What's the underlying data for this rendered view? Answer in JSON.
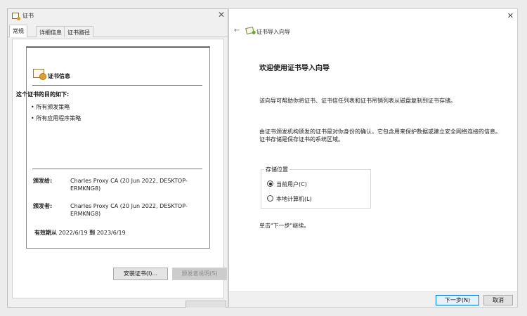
{
  "cert_window": {
    "title": "证书",
    "close_glyph": "✕",
    "icon": "certificate-icon",
    "tabs": [
      {
        "label": "常规",
        "active": true
      },
      {
        "label": "详细信息",
        "active": false
      },
      {
        "label": "证书路径",
        "active": false
      }
    ],
    "info": {
      "heading": "证书信息",
      "purpose_heading": "这个证书的目的如下:",
      "purposes": [
        "所有颁发策略",
        "所有应用程序策略"
      ],
      "issued_to_label": "颁发给:",
      "issued_to_value": "Charles Proxy CA (20 Jun 2022, DESKTOP-ERMKNG8)",
      "issued_by_label": "颁发者:",
      "issued_by_value": "Charles Proxy CA (20 Jun 2022, DESKTOP-ERMKNG8)",
      "valid_from_label": "有效期从",
      "valid_from": "2022/6/19",
      "valid_to_label": "到",
      "valid_to": "2023/6/19"
    },
    "buttons": {
      "install": "安装证书(I)...",
      "issuer_statement": "颁发者说明(S)"
    }
  },
  "wizard": {
    "title": "证书导入向导",
    "back_glyph": "←",
    "close_glyph": "✕",
    "icon": "certificate-import-icon",
    "welcome": "欢迎使用证书导入向导",
    "paragraph1": "该向导可帮助你将证书、证书信任列表和证书吊销列表从磁盘复制到证书存储。",
    "paragraph2": "由证书颁发机构颁发的证书是对你身份的确认，它包含用来保护数据或建立安全网络连接的信息。证书存储是保存证书的系统区域。",
    "store_location": {
      "legend": "存储位置",
      "options": [
        {
          "label": "当前用户(C)",
          "checked": true
        },
        {
          "label": "本地计算机(L)",
          "checked": false
        }
      ]
    },
    "continue_text": "单击\"下一步\"继续。",
    "buttons": {
      "next": "下一步(N)",
      "cancel": "取消"
    }
  },
  "colors": {
    "accent": "#0078d7",
    "window_bg": "#f0f0f0",
    "panel_bg": "#ffffff"
  }
}
